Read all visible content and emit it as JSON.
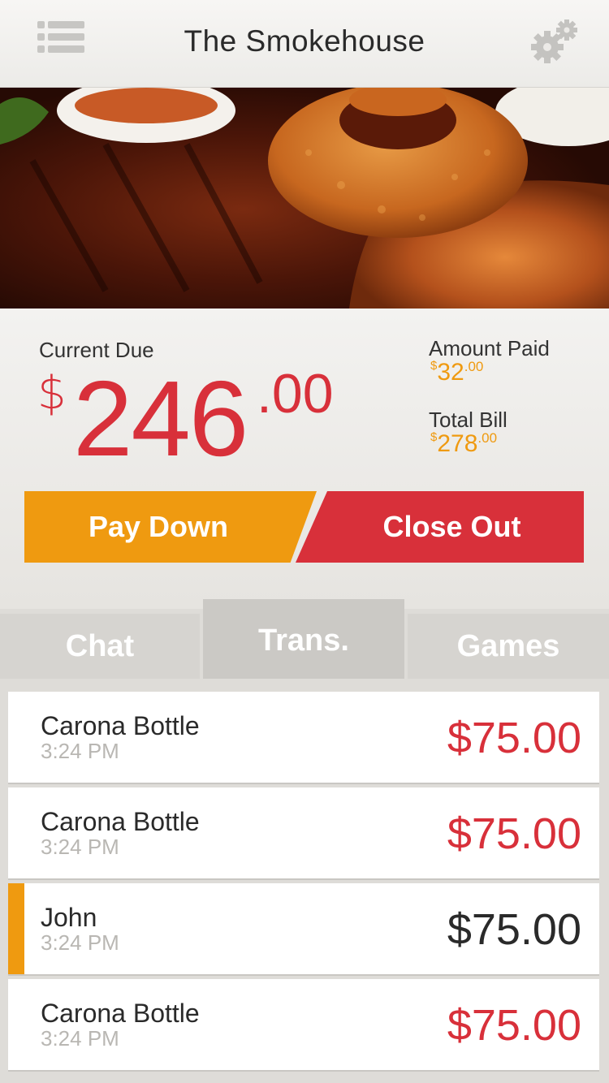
{
  "header": {
    "title": "The Smokehouse"
  },
  "summary": {
    "current_due_label": "Current Due",
    "current_due": {
      "symbol": "$",
      "whole": "246",
      "cents": ".00"
    },
    "amount_paid_label": "Amount Paid",
    "amount_paid": {
      "symbol": "$",
      "whole": "32",
      "cents": ".00"
    },
    "total_bill_label": "Total Bill",
    "total_bill": {
      "symbol": "$",
      "whole": "278",
      "cents": ".00"
    }
  },
  "actions": {
    "pay_down": "Pay Down",
    "close_out": "Close Out"
  },
  "tabs": [
    {
      "label": "Chat"
    },
    {
      "label": "Trans."
    },
    {
      "label": "Games"
    }
  ],
  "transactions": [
    {
      "name": "Carona Bottle",
      "time": "3:24 PM",
      "amount": "$75.00"
    },
    {
      "name": "Carona Bottle",
      "time": "3:24 PM",
      "amount": "$75.00"
    },
    {
      "name": "John",
      "time": "3:24 PM",
      "amount": "$75.00"
    },
    {
      "name": "Carona Bottle",
      "time": "3:24 PM",
      "amount": "$75.00"
    }
  ],
  "colors": {
    "red": "#d8303a",
    "orange": "#ef9a10",
    "dark": "#2a2a2a"
  },
  "icons": {
    "menu": "menu-icon",
    "settings": "gears-icon"
  }
}
